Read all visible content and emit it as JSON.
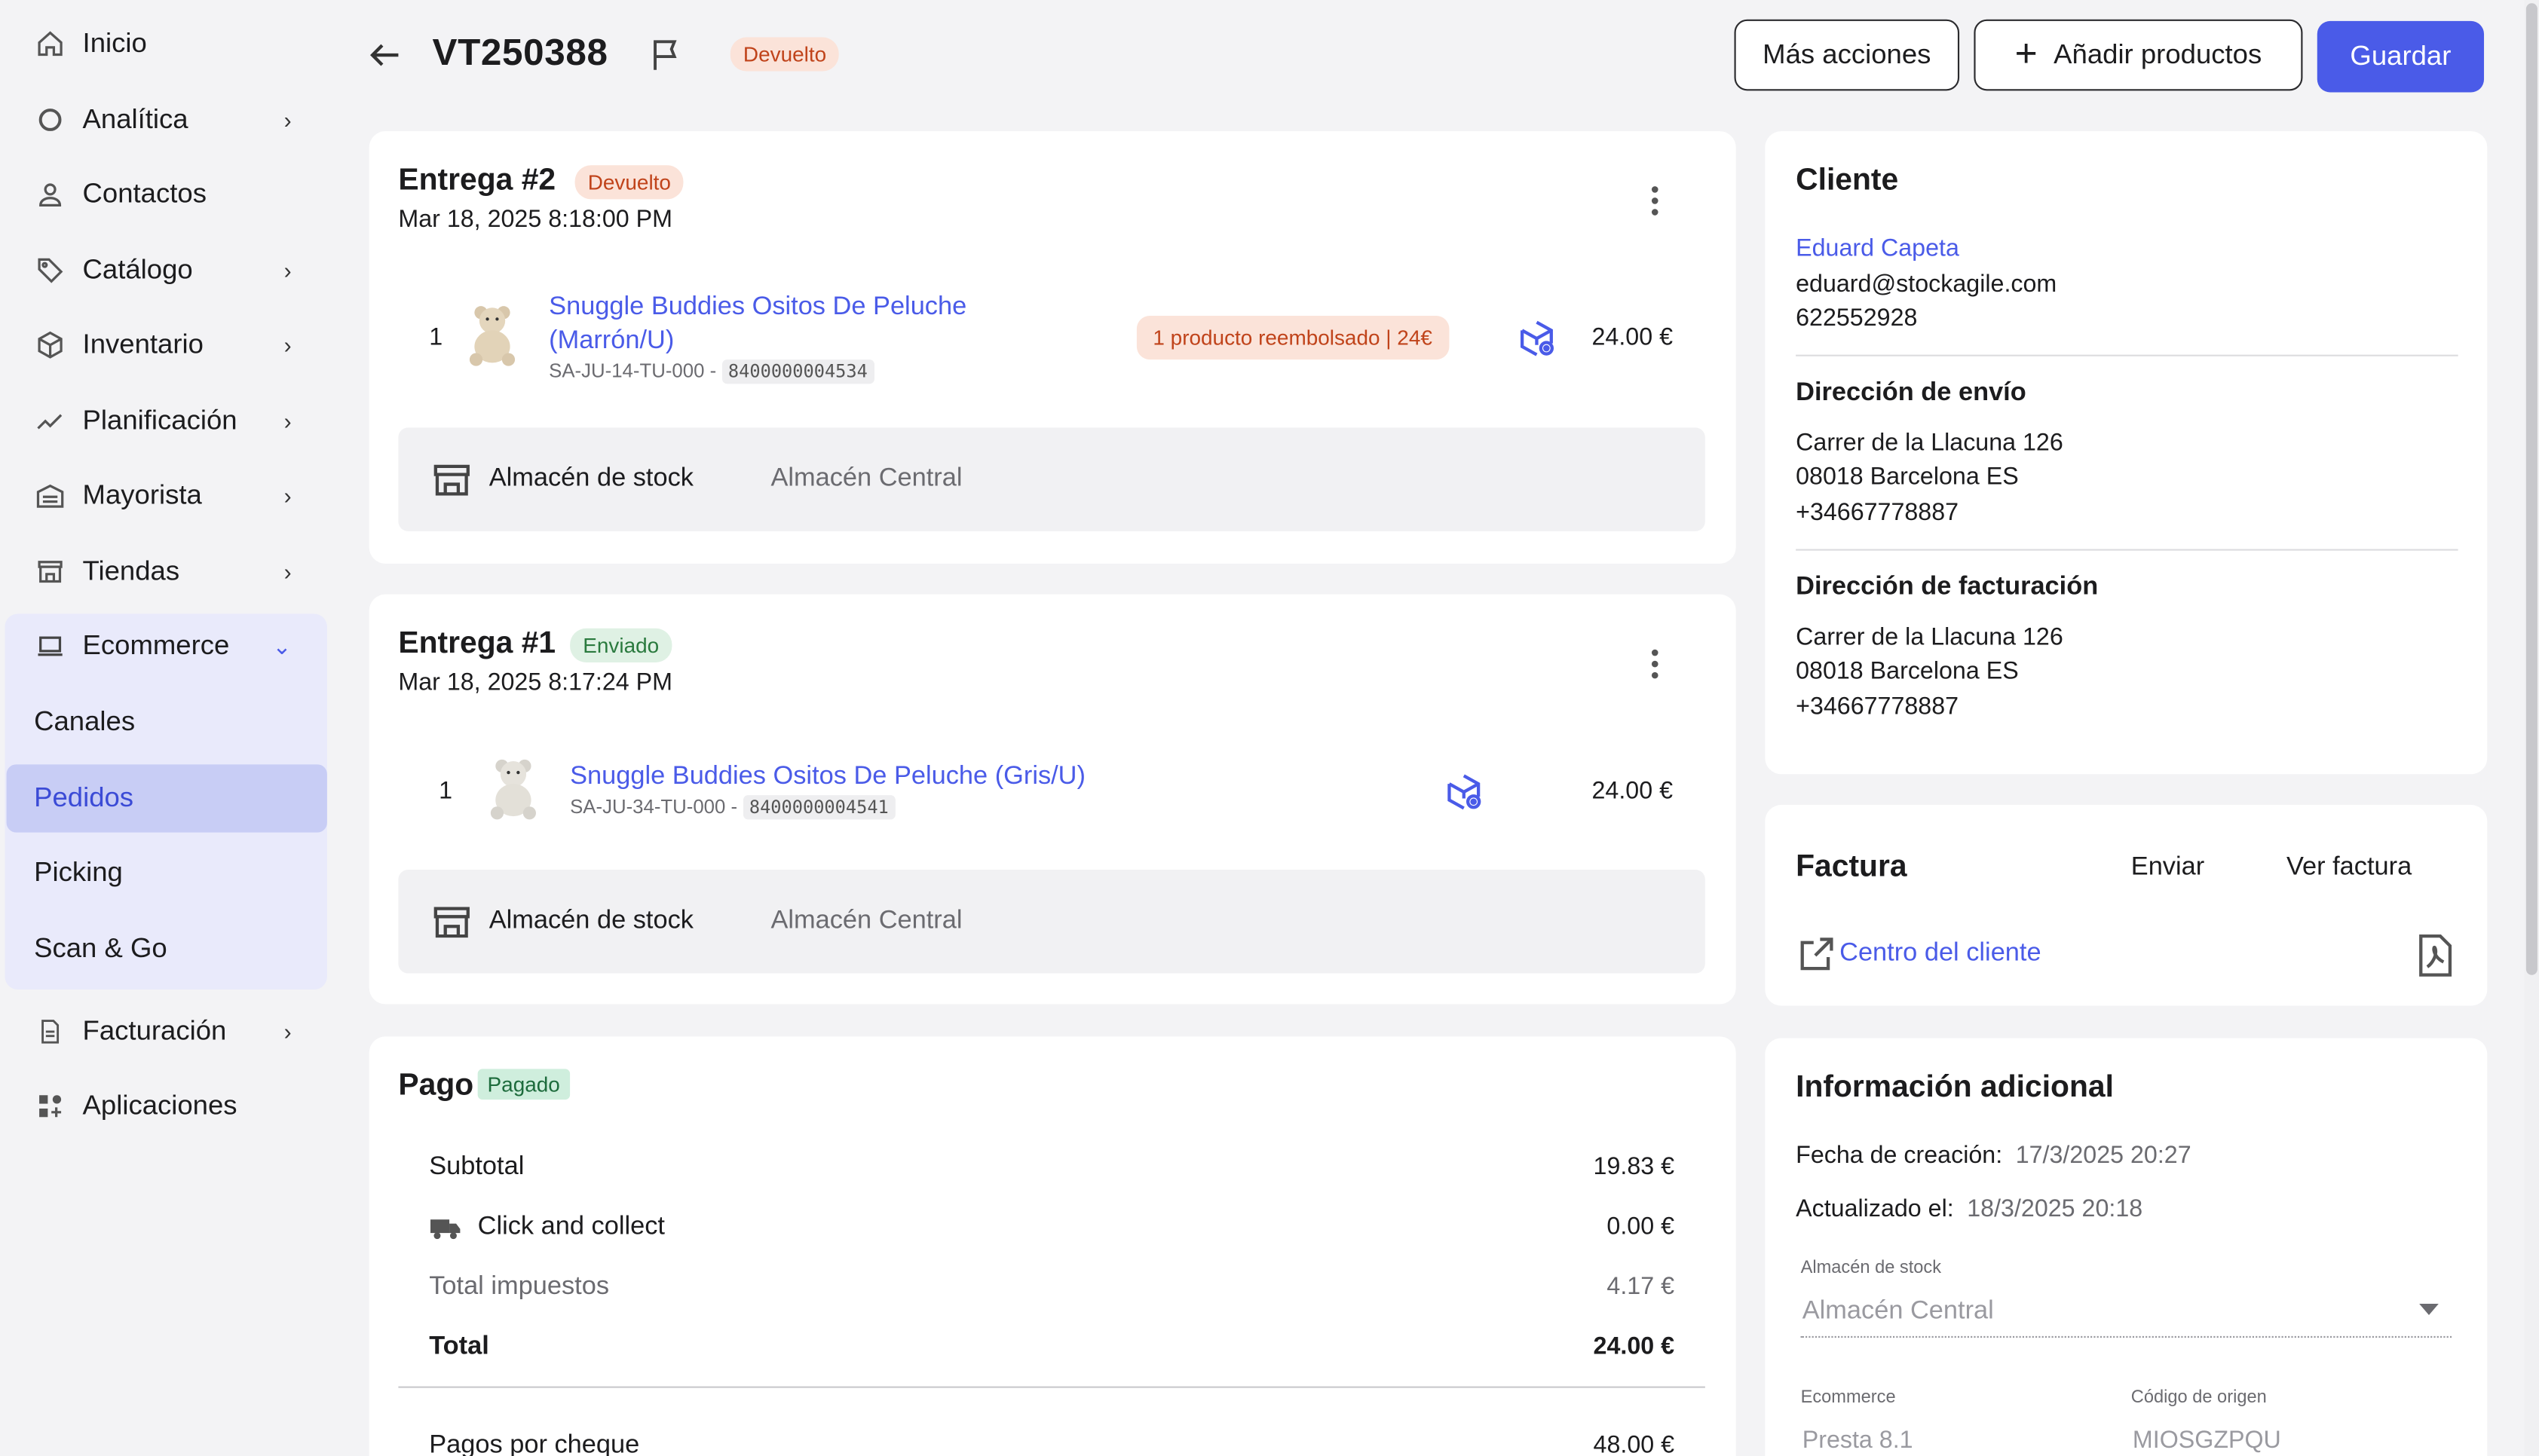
{
  "sidebar": {
    "items": [
      {
        "label": "Inicio",
        "icon": "home-icon"
      },
      {
        "label": "Analítica",
        "icon": "chart-pie-icon"
      },
      {
        "label": "Contactos",
        "icon": "user-icon"
      },
      {
        "label": "Catálogo",
        "icon": "tag-icon"
      },
      {
        "label": "Inventario",
        "icon": "box-icon"
      },
      {
        "label": "Planificación",
        "icon": "trend-icon"
      },
      {
        "label": "Mayorista",
        "icon": "warehouse-icon"
      },
      {
        "label": "Tiendas",
        "icon": "store-icon"
      },
      {
        "label": "Ecommerce",
        "icon": "laptop-icon"
      }
    ],
    "ecommerce_sub": [
      "Canales",
      "Pedidos",
      "Picking",
      "Scan & Go"
    ],
    "bottom_items": [
      {
        "label": "Facturación",
        "icon": "document-icon"
      },
      {
        "label": "Aplicaciones",
        "icon": "apps-icon"
      }
    ]
  },
  "header": {
    "order_id": "VT250388",
    "status": "Devuelto",
    "more_actions": "Más acciones",
    "add_products": "Añadir productos",
    "save": "Guardar"
  },
  "deliveries": [
    {
      "title": "Entrega #2",
      "status": "Devuelto",
      "date": "Mar 18, 2025 8:18:00 PM",
      "qty": "1",
      "product_line1": "Snuggle Buddies Ositos De Peluche",
      "product_line2": "(Marrón/U)",
      "sku": "SA-JU-14-TU-000 - ",
      "ean": "8400000004534",
      "refund": "1 producto reembolsado | 24€",
      "price": "24.00 €",
      "warehouse_label": "Almacén de stock",
      "warehouse_value": "Almacén Central"
    },
    {
      "title": "Entrega #1",
      "status": "Enviado",
      "date": "Mar 18, 2025 8:17:24 PM",
      "qty": "1",
      "product_line1": "Snuggle Buddies Ositos De Peluche (Gris/U)",
      "sku": "SA-JU-34-TU-000 - ",
      "ean": "8400000004541",
      "price": "24.00 €",
      "warehouse_label": "Almacén de stock",
      "warehouse_value": "Almacén Central"
    }
  ],
  "payment": {
    "title": "Pago",
    "status": "Pagado",
    "subtotal_label": "Subtotal",
    "subtotal": "19.83 €",
    "shipping_label": "Click and collect",
    "shipping": "0.00 €",
    "tax_label": "Total impuestos",
    "tax": "4.17 €",
    "total_label": "Total",
    "total": "24.00 €",
    "cheque_label": "Pagos por cheque",
    "cheque": "48.00 €"
  },
  "client": {
    "title": "Cliente",
    "name": "Eduard Capeta",
    "email": "eduard@stockagile.com",
    "phone": "622552928",
    "shipping_title": "Dirección de envío",
    "shipping_lines": [
      "Carrer de la Llacuna 126",
      "08018 Barcelona ES",
      "+34667778887"
    ],
    "billing_title": "Dirección de facturación",
    "billing_lines": [
      "Carrer de la Llacuna 126",
      "08018 Barcelona ES",
      "+34667778887"
    ]
  },
  "invoice": {
    "title": "Factura",
    "send": "Enviar",
    "view": "Ver factura",
    "customer_center": "Centro del cliente"
  },
  "additional": {
    "title": "Información adicional",
    "created_label": "Fecha de creación:",
    "created": "17/3/2025 20:27",
    "updated_label": "Actualizado el:",
    "updated": "18/3/2025 20:18",
    "stock_label": "Almacén de stock",
    "stock_value": "Almacén Central",
    "ecommerce_label": "Ecommerce",
    "ecommerce_value": "Presta 8.1",
    "origin_label": "Código de origen",
    "origin_value": "MIOSGZPQU"
  },
  "colors": {
    "accent": "#4a5be8",
    "returned": "#c0431a",
    "sent": "#2a7a3e"
  }
}
